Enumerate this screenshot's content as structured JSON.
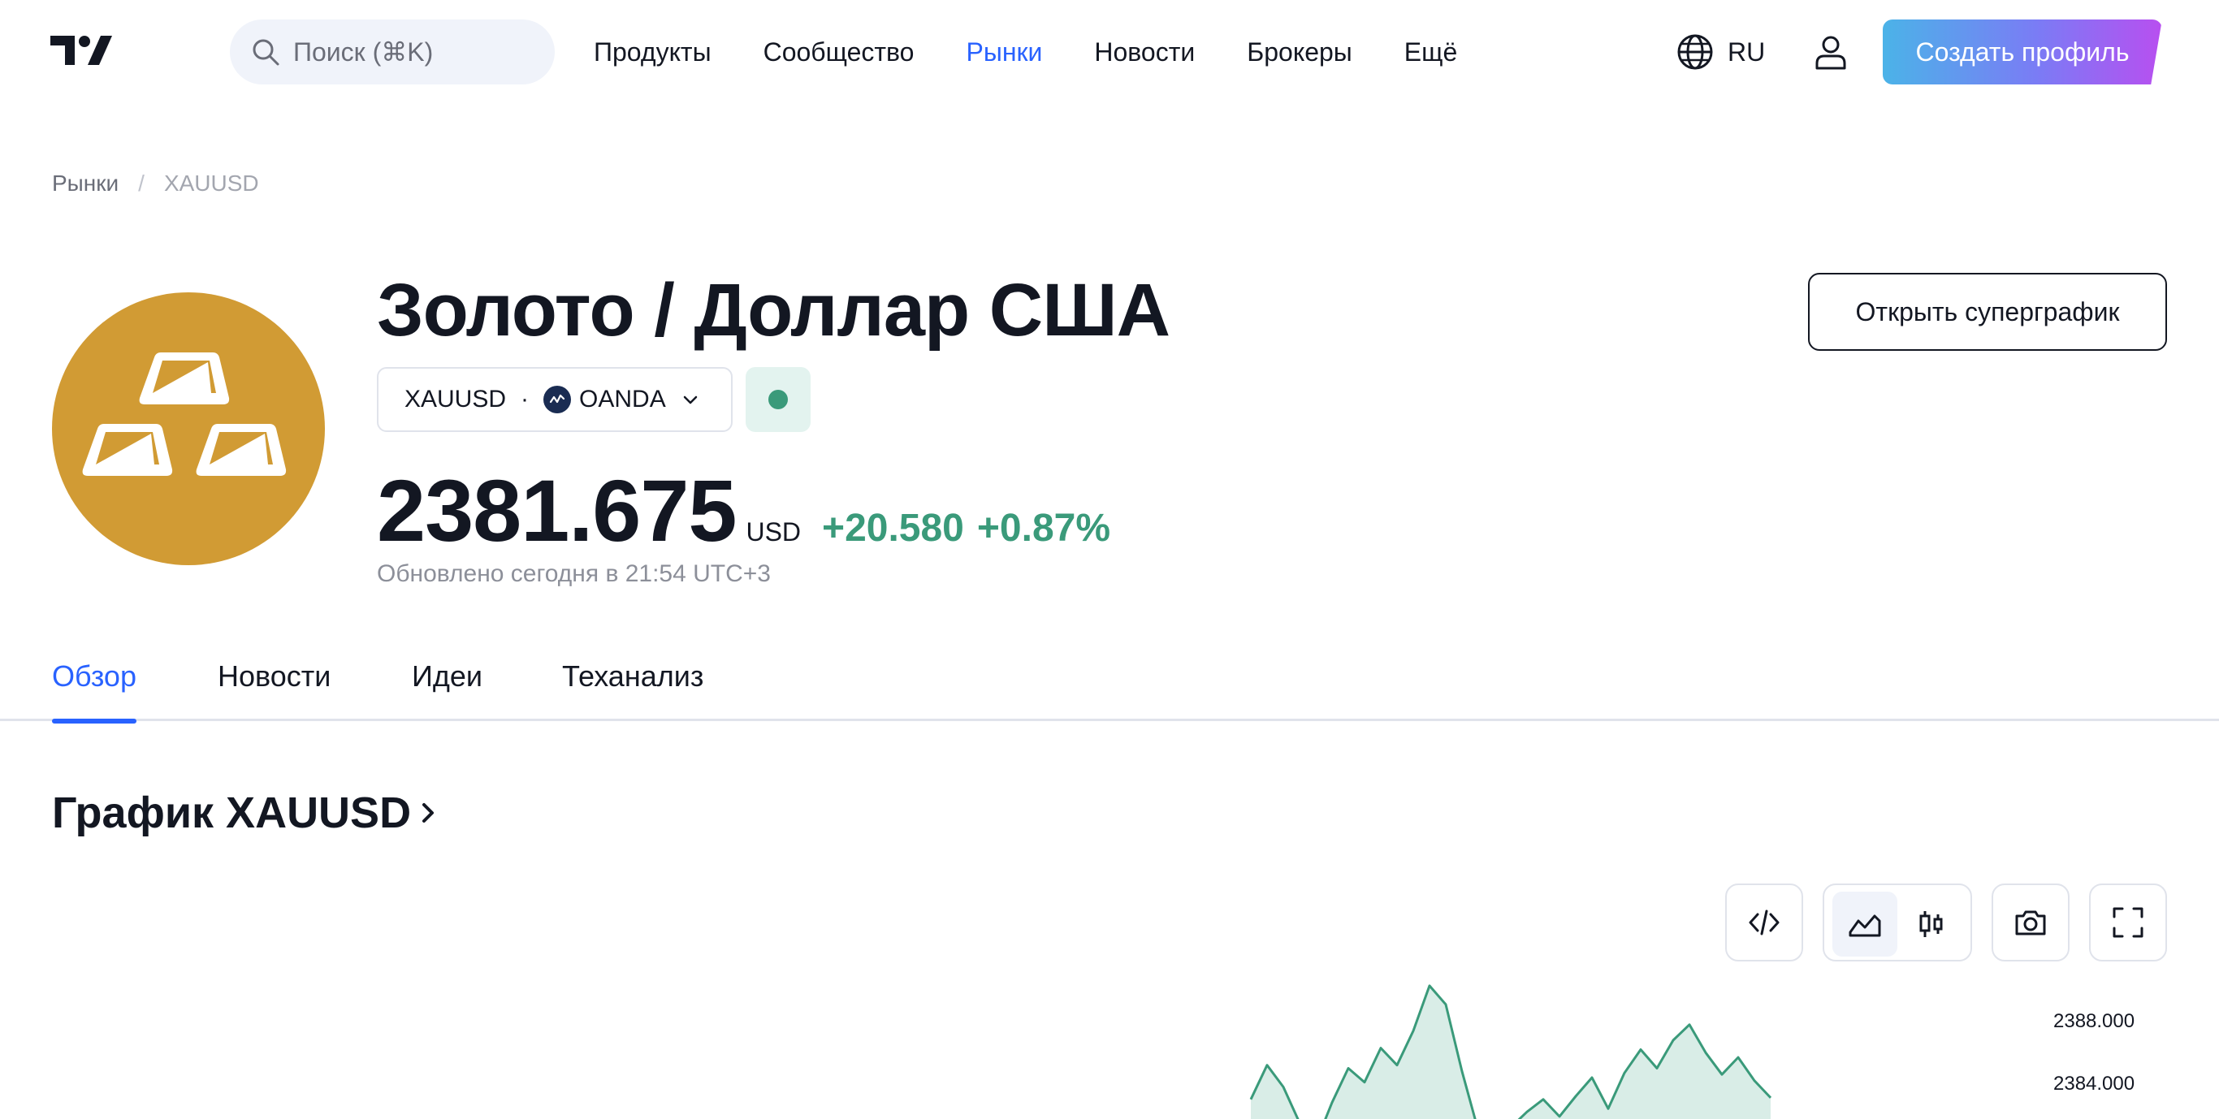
{
  "header": {
    "search_placeholder": "Поиск (⌘K)",
    "nav": [
      "Продукты",
      "Сообщество",
      "Рынки",
      "Новости",
      "Брокеры",
      "Ещё"
    ],
    "active_nav": "Рынки",
    "lang": "RU",
    "cta": "Создать профиль"
  },
  "breadcrumb": {
    "parent": "Рынки",
    "separator": "/",
    "current": "XAUUSD"
  },
  "symbol": {
    "title": "Золото / Доллар США",
    "ticker": "XAUUSD",
    "dot": "·",
    "broker": "OANDA",
    "price": "2381.675",
    "currency": "USD",
    "change": "+20.580",
    "change_pct": "+0.87%",
    "updated": "Обновлено сегодня в 21:54 UTC+3",
    "open_chart": "Открыть суперграфик",
    "status_color": "#3a9a7a",
    "logo_color": "#d19b34"
  },
  "tabs": [
    "Обзор",
    "Новости",
    "Идеи",
    "Теханализ"
  ],
  "active_tab": "Обзор",
  "chart_section": {
    "title": "График XAUUSD",
    "tools": [
      "embed-icon",
      "area-chart-icon",
      "candles-icon",
      "camera-icon",
      "fullscreen-icon"
    ]
  },
  "chart_data": {
    "type": "area",
    "series": [
      {
        "values": [
          2383.0,
          2385.2,
          2383.8,
          2381.5,
          2380.2,
          2382.8,
          2385.0,
          2384.1,
          2386.3,
          2385.2,
          2387.4,
          2390.3,
          2389.1,
          2384.8,
          2381.0,
          2380.4,
          2381.2,
          2382.2,
          2383.0,
          2381.9,
          2383.2,
          2384.4,
          2382.4,
          2384.7,
          2386.2,
          2385.0,
          2386.8,
          2387.8,
          2386.0,
          2384.6,
          2385.7,
          2384.2,
          2383.1
        ]
      }
    ],
    "colors": {
      "line": "#3a9a7a",
      "fill": "#d5ebe4"
    },
    "ylim": [
      2383.2,
      2390.4
    ],
    "y_ticks": [
      "2388.000",
      "2384.000"
    ]
  }
}
